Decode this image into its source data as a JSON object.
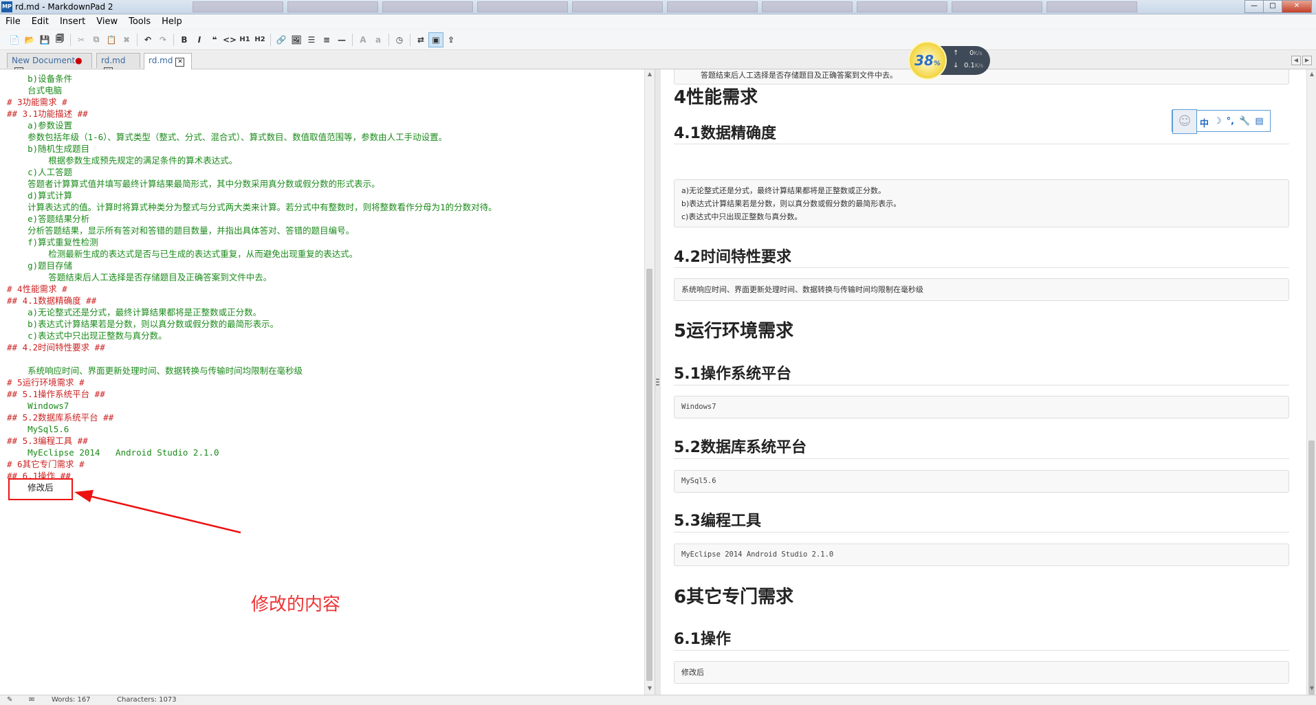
{
  "window": {
    "title": "rd.md - MarkdownPad 2",
    "app_icon": "MP",
    "buttons": [
      "—",
      "□",
      "✕"
    ]
  },
  "menu": [
    "File",
    "Edit",
    "Insert",
    "View",
    "Tools",
    "Help"
  ],
  "toolbar": {
    "icons": [
      "new-document-icon",
      "open-icon",
      "save-icon",
      "save-all-icon",
      "cut-icon",
      "copy-icon",
      "paste-icon",
      "delete-icon",
      "undo-icon",
      "redo-icon",
      "bold-icon",
      "italic-icon",
      "quote-icon",
      "code-icon",
      "heading1-icon",
      "heading2-icon",
      "link-icon",
      "image-icon",
      "unordered-list-icon",
      "ordered-list-icon",
      "horizontal-rule-icon",
      "uppercase-icon",
      "lowercase-icon",
      "timestamp-icon",
      "live-preview-icon",
      "split-view-icon",
      "export-icon"
    ],
    "labels": {
      "bold": "B",
      "italic": "I",
      "quote": "❝",
      "code": "<>",
      "h1": "H1",
      "h2": "H2",
      "upper": "A",
      "lower": "a"
    }
  },
  "tabs": [
    {
      "label": "New Document",
      "modified": true
    },
    {
      "label": "rd.md",
      "modified": false
    },
    {
      "label": "rd.md",
      "modified": false,
      "active": true
    }
  ],
  "editor": {
    "lines": [
      {
        "text": "    b)设备条件",
        "kind": "body"
      },
      {
        "text": "    台式电脑",
        "kind": "body"
      },
      {
        "text": "# 3功能需求 #",
        "kind": "heading"
      },
      {
        "text": "## 3.1功能描述 ##",
        "kind": "heading"
      },
      {
        "text": "    a)参数设置",
        "kind": "body"
      },
      {
        "text": "    参数包括年级（1-6）、算式类型（整式、分式、混合式）、算式数目、数值取值范围等，参数由人工手动设置。",
        "kind": "body"
      },
      {
        "text": "    b)随机生成题目",
        "kind": "body"
      },
      {
        "text": "        根据参数生成预先规定的满足条件的算术表达式。",
        "kind": "body"
      },
      {
        "text": "    c)人工答题",
        "kind": "body"
      },
      {
        "text": "    答题者计算算式值并填写最终计算结果最简形式，其中分数采用真分数或假分数的形式表示。",
        "kind": "body"
      },
      {
        "text": "    d)算式计算",
        "kind": "body"
      },
      {
        "text": "    计算表达式的值。计算时将算式种类分为整式与分式两大类来计算。若分式中有整数时，则将整数看作分母为1的分数对待。",
        "kind": "body"
      },
      {
        "text": "    e)答题结果分析",
        "kind": "body"
      },
      {
        "text": "    分析答题结果，显示所有答对和答错的题目数量，并指出具体答对、答错的题目编号。",
        "kind": "body"
      },
      {
        "text": "    f)算式重复性检测",
        "kind": "body"
      },
      {
        "text": "        检测最新生成的表达式是否与已生成的表达式重复，从而避免出现重复的表达式。",
        "kind": "body"
      },
      {
        "text": "    g)题目存储",
        "kind": "body"
      },
      {
        "text": "        答题结束后人工选择是否存储题目及正确答案到文件中去。",
        "kind": "body"
      },
      {
        "text": "# 4性能需求 #",
        "kind": "heading"
      },
      {
        "text": "## 4.1数据精确度 ##",
        "kind": "heading"
      },
      {
        "text": "    a)无论整式还是分式，最终计算结果都将是正整数或正分数。",
        "kind": "body"
      },
      {
        "text": "    b)表达式计算结果若是分数，则以真分数或假分数的最简形表示。",
        "kind": "body"
      },
      {
        "text": "    c)表达式中只出现正整数与真分数。",
        "kind": "body"
      },
      {
        "text": "## 4.2时间特性要求 ##",
        "kind": "heading"
      },
      {
        "text": "",
        "kind": "body"
      },
      {
        "text": "    系统响应时间、界面更新处理时间、数据转换与传输时间均限制在毫秒级",
        "kind": "body"
      },
      {
        "text": "# 5运行环境需求 #",
        "kind": "heading"
      },
      {
        "text": "## 5.1操作系统平台 ##",
        "kind": "heading"
      },
      {
        "text": "    Windows7",
        "kind": "body"
      },
      {
        "text": "## 5.2数据库系统平台 ##",
        "kind": "heading"
      },
      {
        "text": "    MySql5.6",
        "kind": "body"
      },
      {
        "text": "## 5.3编程工具 ##",
        "kind": "heading"
      },
      {
        "text": "    MyEclipse 2014   Android Studio 2.1.0",
        "kind": "body"
      },
      {
        "text": "# 6其它专门需求 #",
        "kind": "heading"
      },
      {
        "text": "## 6.1操作 ##",
        "kind": "heading"
      },
      {
        "text": "    修改后",
        "kind": "body-black"
      }
    ]
  },
  "annotation": {
    "text": "修改的内容",
    "color": "#e11111"
  },
  "preview": {
    "top_block": "答题结束后人工选择是否存储题目及正确答案到文件中去。",
    "h1_4": "4性能需求",
    "h2_41": "4.1数据精确度",
    "block_41": [
      "a)无论整式还是分式，最终计算结果都将是正整数或正分数。",
      "b)表达式计算结果若是分数，则以真分数或假分数的最简形表示。",
      "c)表达式中只出现正整数与真分数。"
    ],
    "h2_42": "4.2时间特性要求",
    "block_42": "系统响应时间、界面更新处理时间、数据转换与传输时间均限制在毫秒级",
    "h1_5": "5运行环境需求",
    "h2_51": "5.1操作系统平台",
    "block_51": "Windows7",
    "h2_52": "5.2数据库系统平台",
    "block_52": "MySql5.6",
    "h2_53": "5.3编程工具",
    "block_53": "MyEclipse 2014   Android Studio 2.1.0",
    "h1_6": "6其它专门需求",
    "h2_61": "6.1操作",
    "block_61": "修改后"
  },
  "speed_widget": {
    "percent": "38",
    "percent_sign": "%",
    "up": "0",
    "down": "0.1",
    "unit": "K/s"
  },
  "ime": {
    "items": [
      "中",
      "☽",
      "°,",
      "🔧",
      "▤"
    ]
  },
  "statusbar": {
    "words": "Words: 167",
    "chars": "Characters: 1073"
  }
}
